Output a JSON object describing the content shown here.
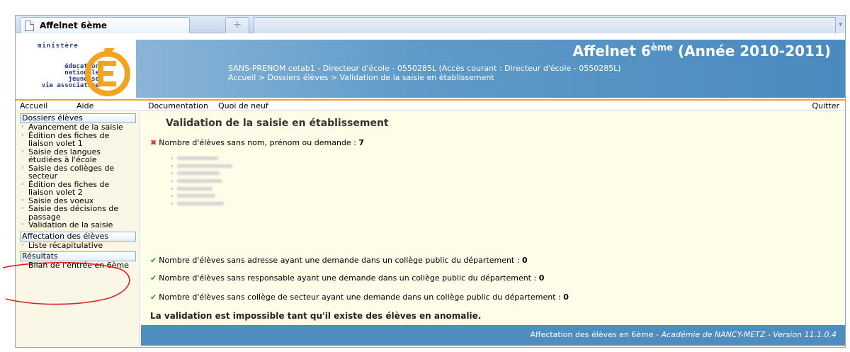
{
  "tabs": {
    "active_label": "Affelnet 6ème",
    "new_tab_symbol": "+"
  },
  "header": {
    "logo_ministry": "ministère",
    "logo_lines": [
      "éducation",
      "nationale",
      "jeunesse",
      "vie associative"
    ],
    "app_title_main": "Affelnet 6",
    "app_title_sup": "ème",
    "app_title_year": " (Année 2010-2011)",
    "user_info": "SANS-PRENOM cetab1 - Directeur d'école - 0550285L (Accès courant : Directeur d'école - 0550285L)",
    "breadcrumb": "Accueil > Dossiers élèves > Validation de la saisie en établissement"
  },
  "menu": {
    "accueil": "Accueil",
    "aide": "Aide",
    "documentation": "Documentation",
    "quoi_de_neuf": "Quoi de neuf",
    "quitter": "Quitter"
  },
  "sidebar": {
    "sections": [
      {
        "title": "Dossiers élèves",
        "items": [
          "Avancement de la saisie",
          "Édition des fiches de liaison volet 1",
          "Saisie des langues étudiées à l'école",
          "Saisie des collèges de secteur",
          "Édition des fiches de liaison volet 2",
          "Saisie des voeux",
          "Saisie des décisions de passage",
          "Validation de la saisie"
        ]
      },
      {
        "title": "Affectation des élèves",
        "items": [
          "Liste récapitulative"
        ]
      },
      {
        "title": "Résultats",
        "items": [
          "Bilan de l'entrée en 6ème"
        ]
      }
    ]
  },
  "main": {
    "title": "Validation de la saisie en établissement",
    "checks": [
      {
        "status": "error",
        "label": "Nombre d'élèves sans nom, prénom ou demande : ",
        "count": "7"
      },
      {
        "status": "ok",
        "label": "Nombre d'élèves sans adresse ayant une demande dans un collège public du département : ",
        "count": "0"
      },
      {
        "status": "ok",
        "label": "Nombre d'élèves sans responsable ayant une demande dans un collège public du département : ",
        "count": "0"
      },
      {
        "status": "ok",
        "label": "Nombre d'élèves sans collège de secteur ayant une demande dans un collège public du département : ",
        "count": "0"
      }
    ],
    "error_message": "La validation est impossible tant qu'il existe des élèves en anomalie."
  },
  "footer": {
    "text": "Affectation des élèves en 6ème - ",
    "academy": "Académie de NANCY-METZ - Version 11.1.0.4"
  },
  "colors": {
    "banner_blue": "#4a8ac0",
    "menu_orange": "#f2a421",
    "content_bg": "#fefde8",
    "ok_green": "#33a02c",
    "error_red": "#d93025",
    "annotation_red": "#e02020"
  },
  "icons": {
    "ok": "check-icon",
    "error": "cross-icon",
    "nav": "chevron-right-icon"
  }
}
